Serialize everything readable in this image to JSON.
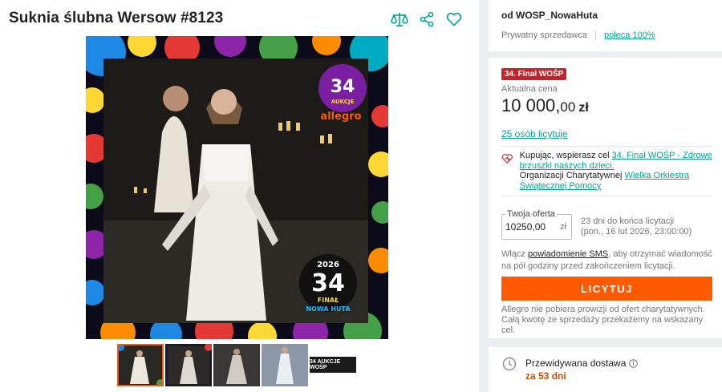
{
  "listing": {
    "title": "Suknia ślubna Wersow #8123",
    "image_overlay": {
      "top_badge_number": "34",
      "top_badge_text": "AUKCJE",
      "top_brand": "allegro",
      "bottom_year": "2026",
      "bottom_number": "34",
      "bottom_final": "FINAŁ",
      "bottom_city": "NOWA HUTA"
    },
    "thumbnails": [
      "thumb-1",
      "thumb-2",
      "thumb-3",
      "thumb-4",
      "thumb-5"
    ],
    "thumb_logo_text": "34 AUKCJE WOŚP"
  },
  "icons": {
    "compare": "compare-icon",
    "share": "share-icon",
    "favorite": "heart-icon"
  },
  "seller": {
    "name": "od WOSP_NowaHuta",
    "type": "Prywatny sprzedawca",
    "recommend": "poleca 100%"
  },
  "offer": {
    "badge": "34. Finał WOŚP",
    "price_label": "Aktualna cena",
    "price_int": "10 000,",
    "price_dec": "00",
    "currency": "zł",
    "bidders": "25 osób licytuje",
    "charity_prefix": "Kupując, wspierasz cel ",
    "charity_link": "34. Finał WOŚP - Zdrowe brzuszki naszych dzieci.",
    "org_prefix": "Organizacji Charytatywnej ",
    "org_link": "Wielka Orkiestra Świątecznej Pomocy",
    "bid_label": "Twoja oferta",
    "bid_value": "10250,00",
    "bid_unit": "zł",
    "time_left": "23 dni do końca licytacji",
    "end_date": "(pon., 16 lut 2026, 23:00:00)",
    "sms_prefix": "Włącz ",
    "sms_link": "powiadomienie SMS",
    "sms_suffix": ", aby otrzymać wiadomość na pół godziny przed zakończeniem licytacji.",
    "bid_button": "LICYTUJ",
    "fee_info": "Allegro nie pobiera prowizji od ofert charytatywnych. Całą kwotę ze sprzedaży przekażemy na wskazany cel."
  },
  "delivery": {
    "label": "Przewidywana dostawa",
    "value": "za 53 dni"
  },
  "colors": {
    "accent": "#ff5a00",
    "link": "#00a790",
    "badge": "#c7222a",
    "delivery": "#c15000"
  }
}
